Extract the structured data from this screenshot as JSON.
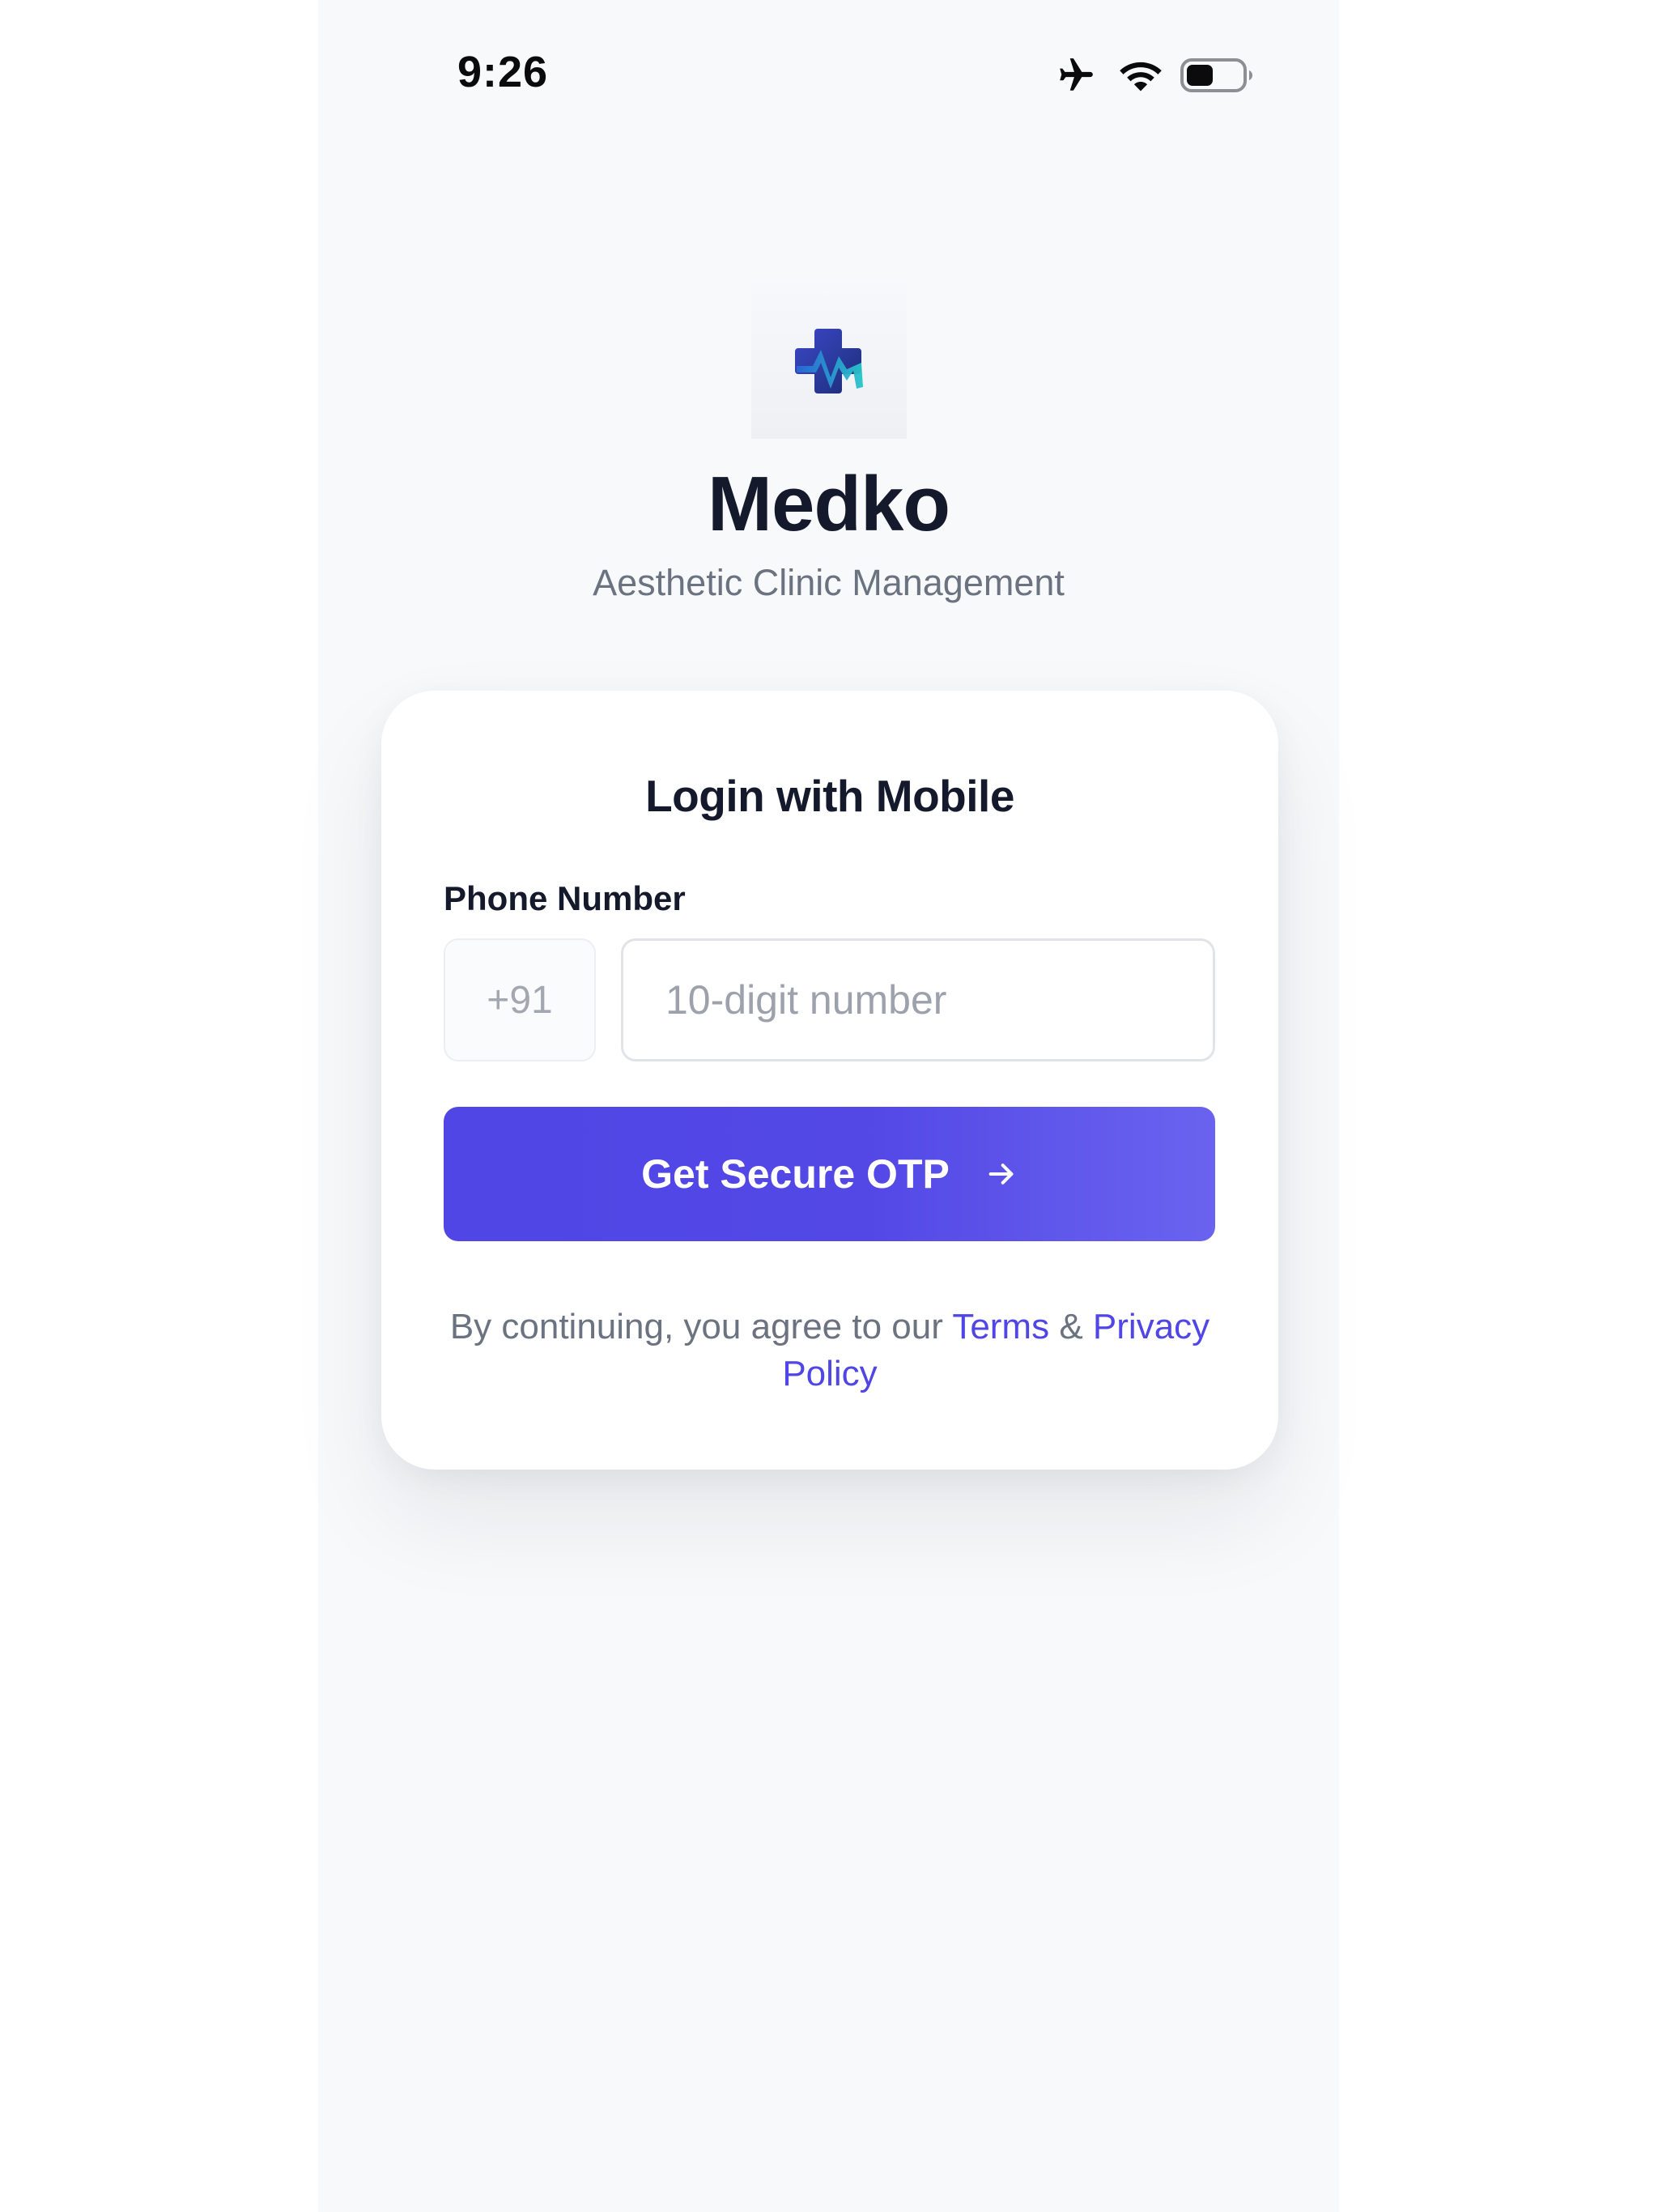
{
  "status_bar": {
    "time": "9:26",
    "icons": [
      "airplane-icon",
      "wifi-icon",
      "battery-icon"
    ]
  },
  "brand": {
    "logo_icon": "medical-cross-logo",
    "name": "Medko",
    "tagline": "Aesthetic Clinic Management"
  },
  "login_card": {
    "title": "Login with Mobile",
    "phone_label": "Phone Number",
    "country_code": "+91",
    "phone_value": "",
    "phone_placeholder": "10-digit number",
    "otp_button_label": "Get Secure OTP",
    "otp_button_icon": "arrow-right-icon",
    "legal_prefix": "By continuing, you agree to our",
    "terms_link": "Terms",
    "legal_and": "&",
    "privacy_link": "Privacy Policy"
  },
  "colors": {
    "accent": "#4f46e5",
    "background": "#f8f9fb",
    "heading": "#141a2b",
    "muted": "#6b7280"
  }
}
